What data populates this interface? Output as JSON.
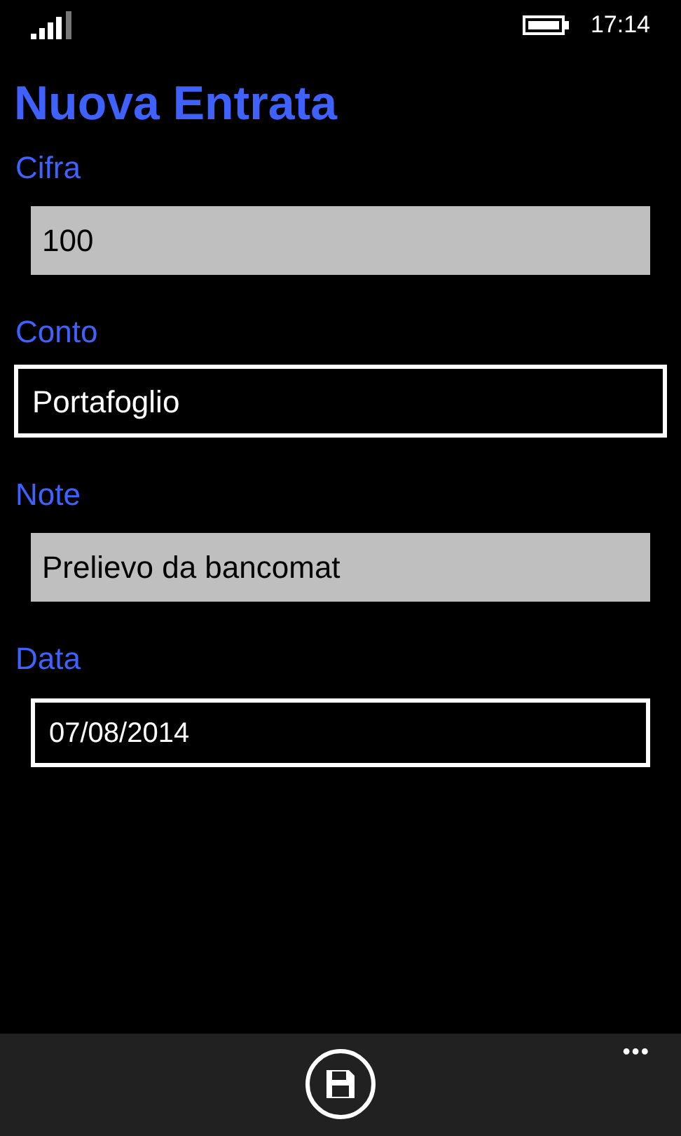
{
  "status_bar": {
    "time": "17:14"
  },
  "title": "Nuova Entrata",
  "fields": [
    {
      "label": "Cifra",
      "kind": "text",
      "value": "100"
    },
    {
      "label": "Conto",
      "kind": "list",
      "value": "Portafoglio"
    },
    {
      "label": "Note",
      "kind": "text",
      "value": "Prelievo da bancomat"
    },
    {
      "label": "Data",
      "kind": "date",
      "value": "07/08/2014"
    }
  ],
  "app_bar": {
    "more": "•••"
  }
}
